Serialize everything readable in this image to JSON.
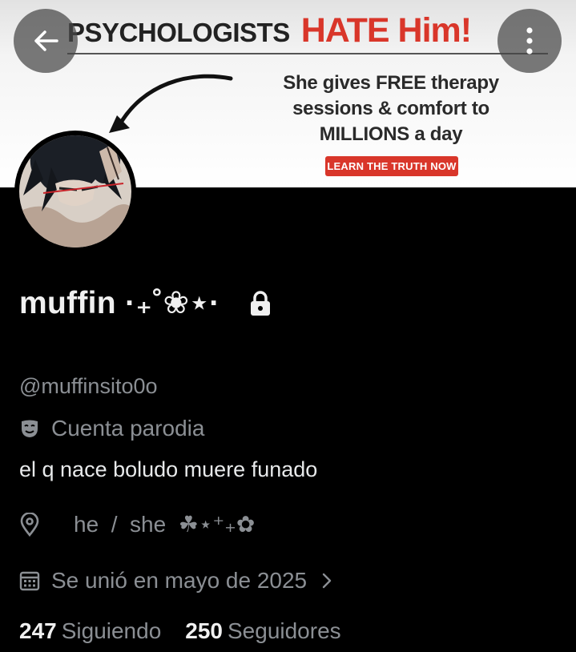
{
  "banner": {
    "headline_part1": "PSYCHOLOGISTS",
    "headline_part2": "HATE Him!",
    "body_line1": "She gives FREE therapy",
    "body_line2": "sessions & comfort to",
    "body_line3": "MILLIONS a day",
    "cta": "LEARN THE TRUTH NOW"
  },
  "profile": {
    "display_name": "muffin ·₊˚❀⋆·",
    "handle": "@muffinsito0o",
    "parody_label": "Cuenta parodia",
    "bio": "el q nace boludo muere funado",
    "location": "he  /  she  ☘︎⋆⁺₊✿",
    "joined": "Se unió en mayo de 2025"
  },
  "stats": {
    "following_count": "247",
    "following_label": "Siguiendo",
    "followers_count": "250",
    "followers_label": "Seguidores"
  },
  "colors": {
    "background": "#000000",
    "primary_text": "#e7e9ea",
    "secondary_text": "#8b8f94",
    "banner_red": "#d9362a"
  },
  "icons": [
    "back-arrow-icon",
    "more-vertical-icon",
    "lock-icon",
    "parody-mask-icon",
    "location-pin-icon",
    "calendar-icon",
    "chevron-right-icon"
  ]
}
